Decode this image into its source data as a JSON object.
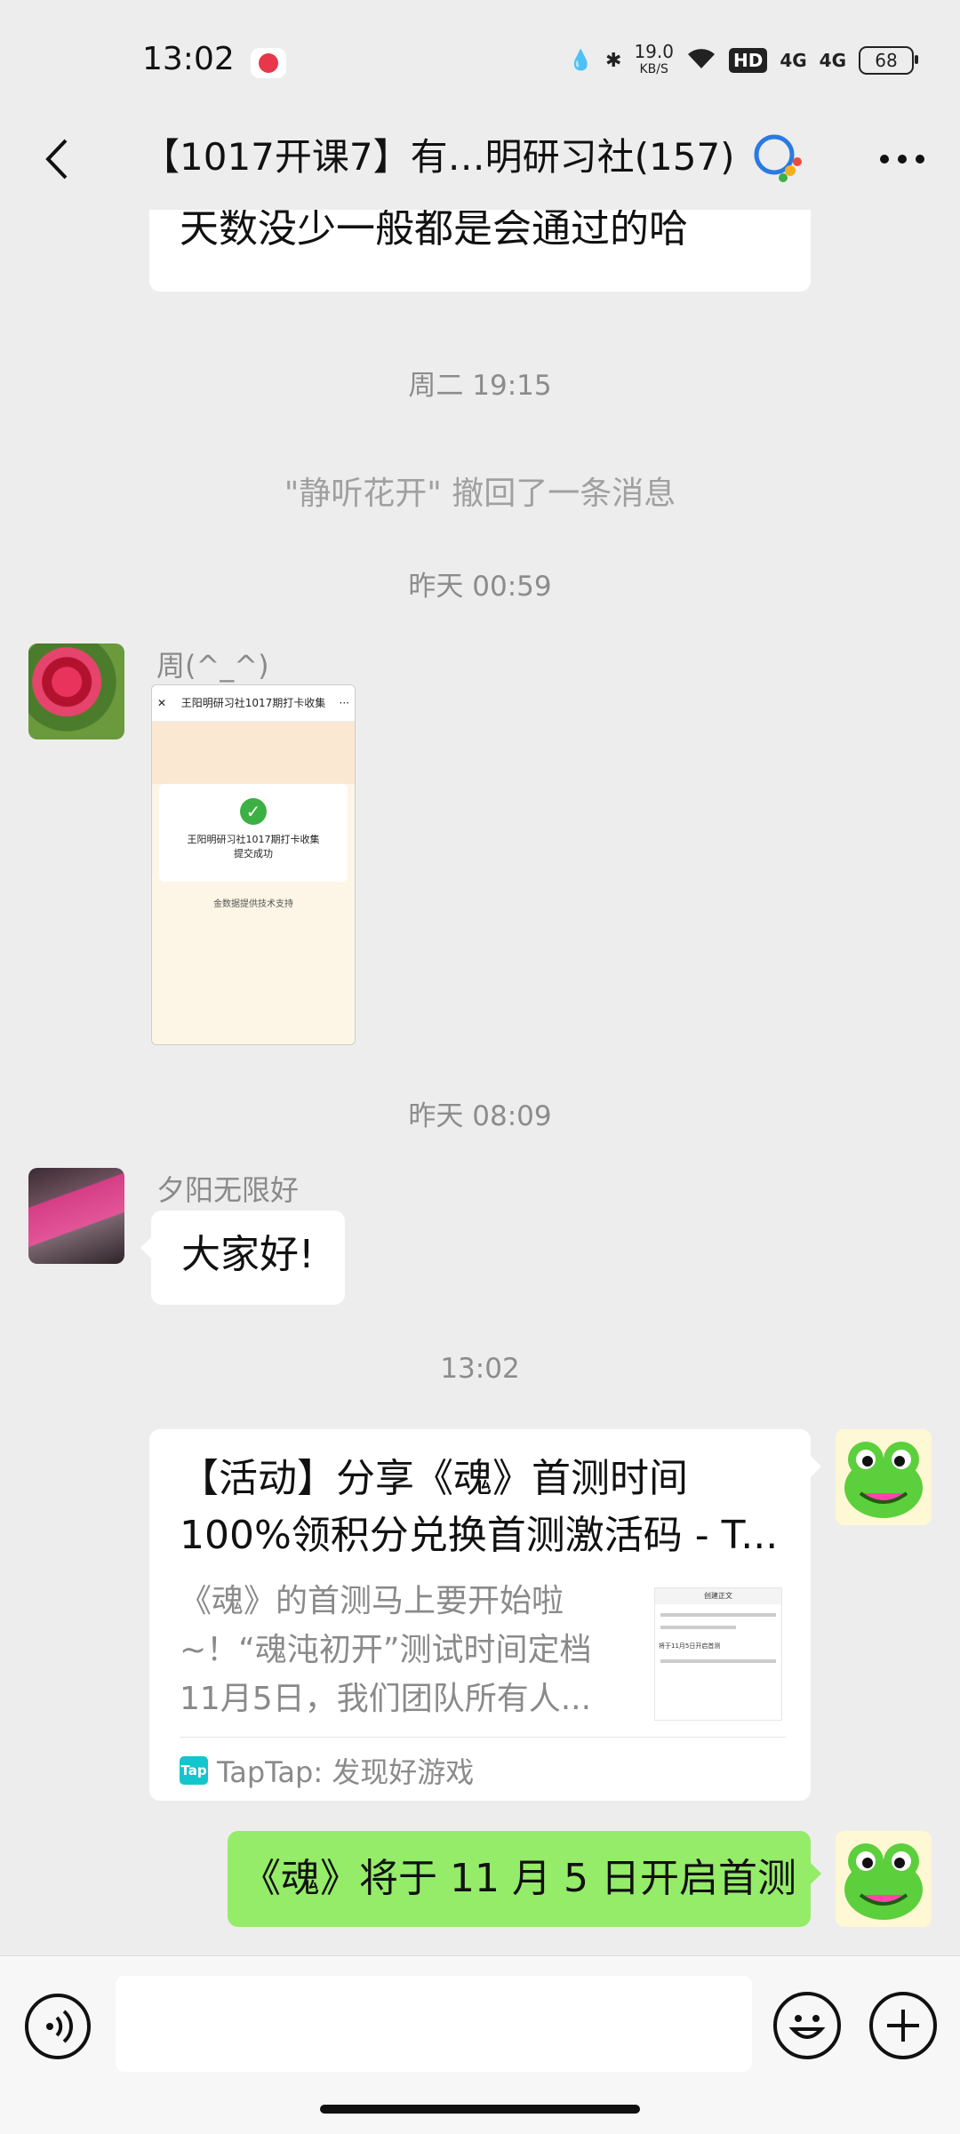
{
  "status_bar": {
    "time": "13:02",
    "net_speed_value": "19.0",
    "net_speed_unit": "KB/S",
    "hd_label": "HD",
    "signal1": "4G",
    "signal2": "4G",
    "battery": "68"
  },
  "header": {
    "title": "【1017开课7】有…明研习社(157)"
  },
  "messages": {
    "partial_text_line2": "天数没少一般都是会通过的哈",
    "time1": "周二 19:15",
    "recall_notice": "\"静听花开\" 撤回了一条消息",
    "time2": "昨天 00:59",
    "sender1": "周(^_^)",
    "image_card": {
      "top_title": "王阳明研习社1017期打卡收集",
      "ok_text1": "王阳明研习社1017期打卡收集",
      "ok_text2": "提交成功",
      "footer": "金数据提供技术支持"
    },
    "time3": "昨天 08:09",
    "sender2": "夕阳无限好",
    "greeting": "大家好!",
    "time4": "13:02",
    "link_card": {
      "title_line1": "【活动】分享《魂》首测时间",
      "title_line2": "100%领积分兑换首测激活码 - T...",
      "description": "《魂》的首测马上要开始啦~！“魂沌初开”测试时间定档11月5日，我们团队所有人...",
      "thumb_header": "创建正文",
      "thumb_text": "将于11月5日开启首测",
      "source": "TapTap: 发现好游戏",
      "source_icon_text": "Tap"
    },
    "my_message": "《魂》将于 11 月 5 日开启首测"
  },
  "colors": {
    "background": "#ededed",
    "my_bubble": "#95ec69",
    "their_bubble": "#ffffff"
  },
  "icons": [
    "back-arrow-icon",
    "chat-search-icon",
    "more-dots-icon",
    "voice-icon",
    "emoji-icon",
    "plus-icon"
  ]
}
